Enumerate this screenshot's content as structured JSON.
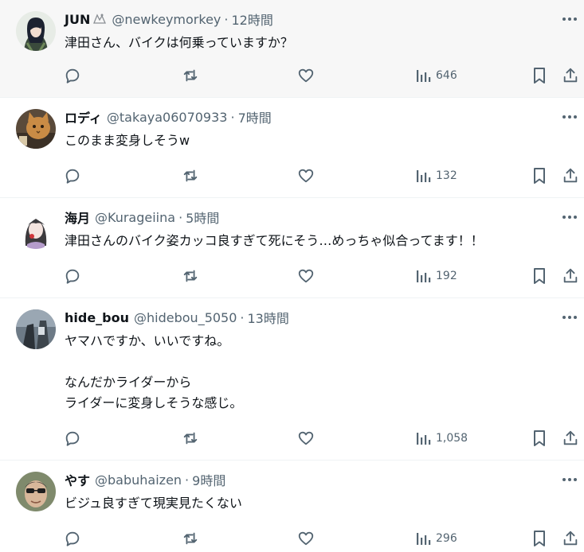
{
  "icons": {
    "reply": "reply-icon",
    "retweet": "retweet-icon",
    "like": "heart-icon",
    "views": "views-chart-icon",
    "bookmark": "bookmark-icon",
    "share": "share-icon",
    "more": "more-icon"
  },
  "colors": {
    "text": "#0f1419",
    "secondary": "#536471",
    "border": "#eff3f4",
    "hover_bg": "#f7f7f7"
  },
  "tweets": [
    {
      "name": "JUN",
      "handle": "@newkeymorkey",
      "sep": "·",
      "time": "12時間",
      "text": "津田さん、バイクは何乗っていますか？",
      "views": "646"
    },
    {
      "name": "ロディ",
      "handle": "@takaya06070933",
      "sep": "·",
      "time": "7時間",
      "text": "このまま変身しそうw",
      "views": "132"
    },
    {
      "name": "海月",
      "handle": "@Kurageiina",
      "sep": "·",
      "time": "5時間",
      "text": "津田さんのバイク姿カッコ良すぎて死にそう…めっちゃ似合ってます！！",
      "views": "192"
    },
    {
      "name": "hide_bou",
      "handle": "@hidebou_5050",
      "sep": "·",
      "time": "13時間",
      "text": "ヤマハですか、いいですね。\n\nなんだかライダーから\nライダーに変身しそうな感じ。",
      "views": "1,058"
    },
    {
      "name": "やす",
      "handle": "@babuhaizen",
      "sep": "·",
      "time": "9時間",
      "text": "ビジュ良すぎて現実見たくない",
      "views": "296"
    }
  ]
}
